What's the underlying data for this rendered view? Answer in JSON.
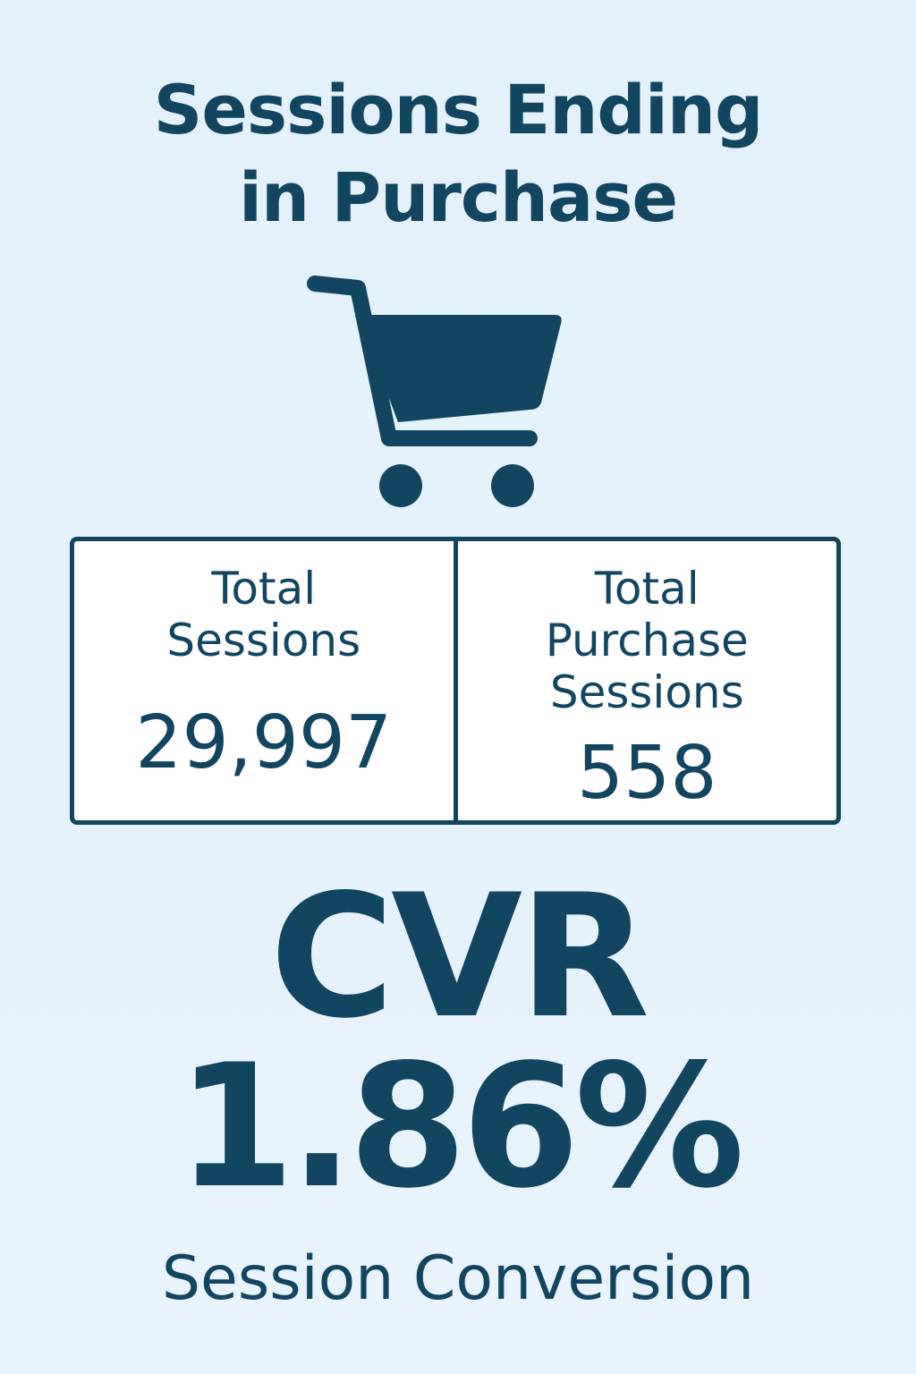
{
  "title": {
    "line1": "Sessions Ending",
    "line2": "in Purchase"
  },
  "icon": "shopping-cart-icon",
  "stats": {
    "total_sessions": {
      "label_line1": "Total",
      "label_line2": "Sessions",
      "value": "29,997"
    },
    "purchase_sessions": {
      "label_line1": "Total",
      "label_line2": "Purchase",
      "label_line3": "Sessions",
      "value": "558"
    }
  },
  "cvr": {
    "label": "CVR",
    "value": "1.86%",
    "caption": "Session Conversion"
  },
  "colors": {
    "background": "#e3f1fb",
    "primary": "#124660",
    "card": "#ffffff"
  }
}
